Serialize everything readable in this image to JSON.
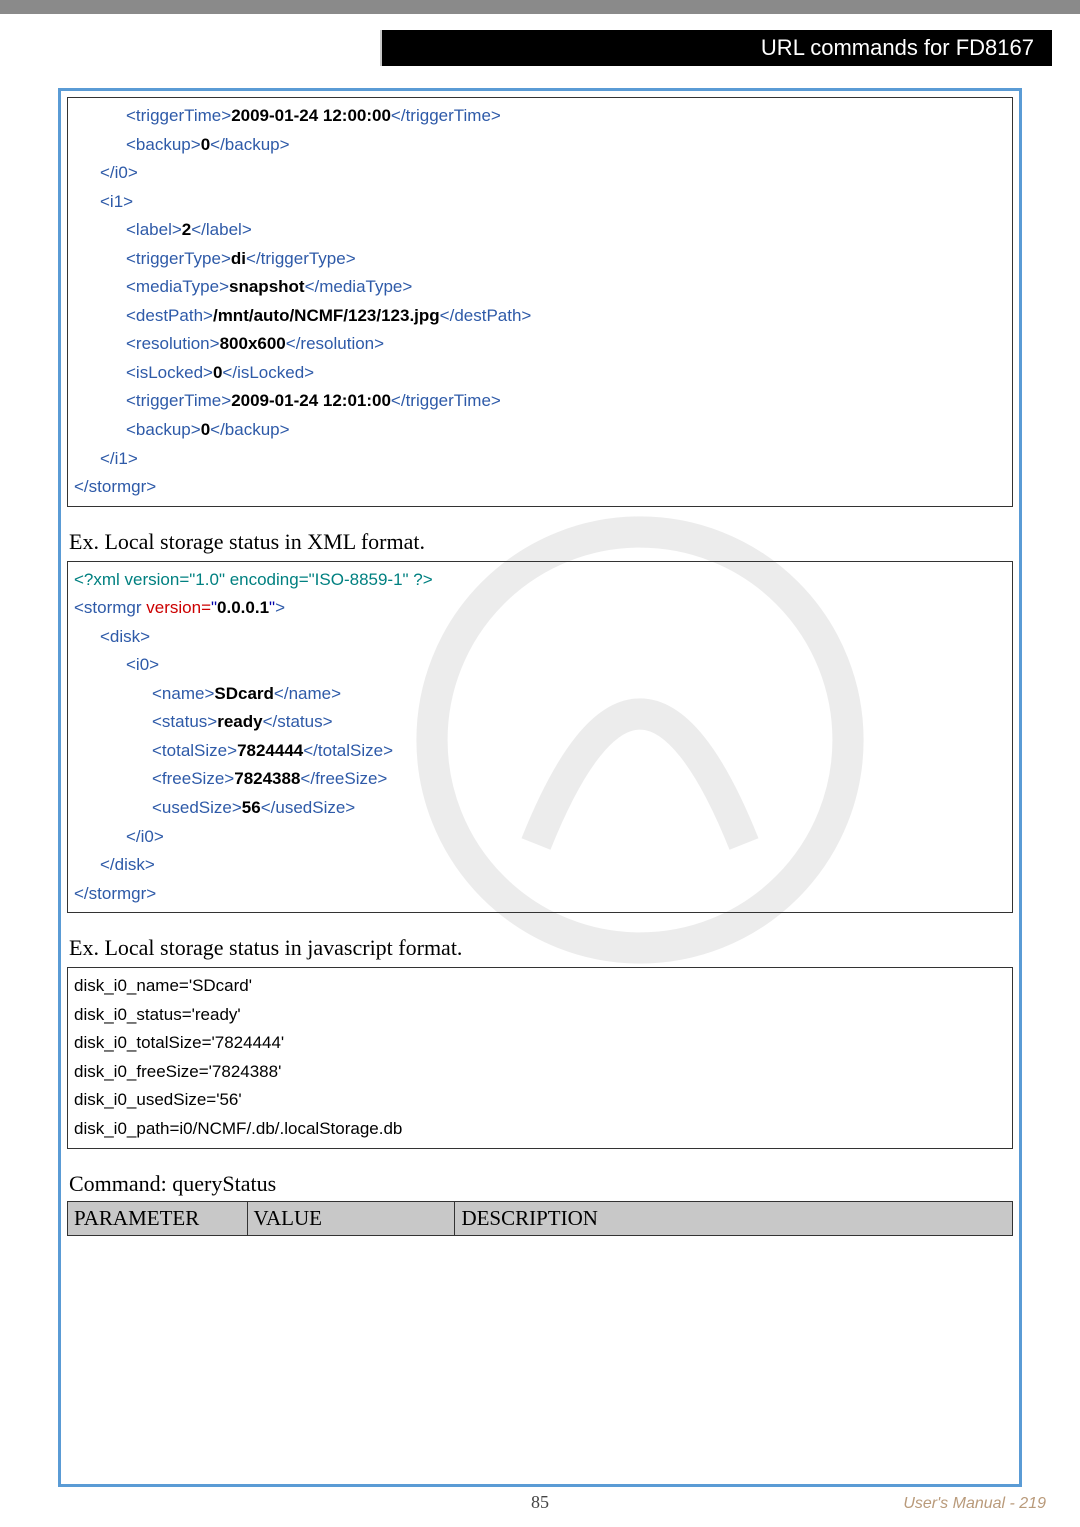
{
  "header": {
    "title": "URL commands for FD8167"
  },
  "block1": {
    "lines": [
      {
        "indent": 2,
        "parts": [
          [
            "tag",
            "<triggerTime>"
          ],
          [
            "text",
            "2009-01-24 12:00:00"
          ],
          [
            "tag",
            "</triggerTime>"
          ]
        ]
      },
      {
        "indent": 2,
        "parts": [
          [
            "tag",
            "<backup>"
          ],
          [
            "text",
            "0"
          ],
          [
            "tag",
            "</backup>"
          ]
        ]
      },
      {
        "indent": 1,
        "parts": [
          [
            "tag",
            "</i0>"
          ]
        ]
      },
      {
        "indent": 1,
        "parts": [
          [
            "tag",
            "<i1>"
          ]
        ]
      },
      {
        "indent": 2,
        "parts": [
          [
            "tag",
            "<label>"
          ],
          [
            "text",
            "2"
          ],
          [
            "tag",
            "</label>"
          ]
        ]
      },
      {
        "indent": 2,
        "parts": [
          [
            "tag",
            "<triggerType>"
          ],
          [
            "text",
            "di"
          ],
          [
            "tag",
            "</triggerType>"
          ]
        ]
      },
      {
        "indent": 2,
        "parts": [
          [
            "tag",
            "<mediaType>"
          ],
          [
            "text",
            "snapshot"
          ],
          [
            "tag",
            "</mediaType>"
          ]
        ]
      },
      {
        "indent": 2,
        "parts": [
          [
            "tag",
            "<destPath>"
          ],
          [
            "text",
            "/mnt/auto/NCMF/123/123.jpg"
          ],
          [
            "tag",
            "</destPath>"
          ]
        ]
      },
      {
        "indent": 2,
        "parts": [
          [
            "tag",
            "<resolution>"
          ],
          [
            "text",
            "800x600"
          ],
          [
            "tag",
            "</resolution>"
          ]
        ]
      },
      {
        "indent": 2,
        "parts": [
          [
            "tag",
            "<isLocked>"
          ],
          [
            "text",
            "0"
          ],
          [
            "tag",
            "</isLocked>"
          ]
        ]
      },
      {
        "indent": 2,
        "parts": [
          [
            "tag",
            "<triggerTime>"
          ],
          [
            "text",
            "2009-01-24 12:01:00"
          ],
          [
            "tag",
            "</triggerTime>"
          ]
        ]
      },
      {
        "indent": 2,
        "parts": [
          [
            "tag",
            "<backup>"
          ],
          [
            "text",
            "0"
          ],
          [
            "tag",
            "</backup>"
          ]
        ]
      },
      {
        "indent": 1,
        "parts": [
          [
            "tag",
            "</i1>"
          ]
        ]
      },
      {
        "indent": 0,
        "parts": [
          [
            "tag",
            "</stormgr>"
          ]
        ]
      }
    ]
  },
  "narr1": "Ex. Local storage status in XML format.",
  "block2": {
    "lines": [
      {
        "indent": 0,
        "parts": [
          [
            "decl",
            "<?xml version=\"1.0\" encoding=\"ISO-8859-1\" ?>"
          ]
        ]
      },
      {
        "indent": 0,
        "parts": [
          [
            "tag",
            "<stormgr"
          ],
          [
            "attr",
            " version="
          ],
          [
            "quote",
            "\""
          ],
          [
            "text",
            "0.0.0.1"
          ],
          [
            "quote",
            "\""
          ],
          [
            "tag",
            ">"
          ]
        ]
      },
      {
        "indent": 1,
        "parts": [
          [
            "tag",
            "<disk>"
          ]
        ]
      },
      {
        "indent": 2,
        "parts": [
          [
            "tag",
            "<i0>"
          ]
        ]
      },
      {
        "indent": 3,
        "parts": [
          [
            "tag",
            "<name>"
          ],
          [
            "text",
            "SDcard"
          ],
          [
            "tag",
            "</name>"
          ]
        ]
      },
      {
        "indent": 3,
        "parts": [
          [
            "tag",
            "<status>"
          ],
          [
            "text",
            "ready"
          ],
          [
            "tag",
            "</status>"
          ]
        ]
      },
      {
        "indent": 3,
        "parts": [
          [
            "tag",
            "<totalSize>"
          ],
          [
            "text",
            "7824444"
          ],
          [
            "tag",
            "</totalSize>"
          ]
        ]
      },
      {
        "indent": 3,
        "parts": [
          [
            "tag",
            "<freeSize>"
          ],
          [
            "text",
            "7824388"
          ],
          [
            "tag",
            "</freeSize>"
          ]
        ]
      },
      {
        "indent": 3,
        "parts": [
          [
            "tag",
            "<usedSize>"
          ],
          [
            "text",
            "56"
          ],
          [
            "tag",
            "</usedSize>"
          ]
        ]
      },
      {
        "indent": 2,
        "parts": [
          [
            "tag",
            "</i0>"
          ]
        ]
      },
      {
        "indent": 1,
        "parts": [
          [
            "tag",
            "</disk>"
          ]
        ]
      },
      {
        "indent": 0,
        "parts": [
          [
            "tag",
            "</stormgr>"
          ]
        ]
      }
    ]
  },
  "narr2": "Ex. Local storage status in javascript format.",
  "block3": {
    "lines": [
      "disk_i0_name='SDcard'",
      "disk_i0_status='ready'",
      "disk_i0_totalSize='7824444'",
      "disk_i0_freeSize='7824388'",
      "disk_i0_usedSize='56'",
      "disk_i0_path=i0/NCMF/.db/.localStorage.db"
    ]
  },
  "command": "Command: queryStatus",
  "paramTable": {
    "hdr": [
      "PARAMETER",
      "VALUE",
      "DESCRIPTION"
    ]
  },
  "footer": {
    "page": "85",
    "manual": "User's Manual - 219"
  }
}
